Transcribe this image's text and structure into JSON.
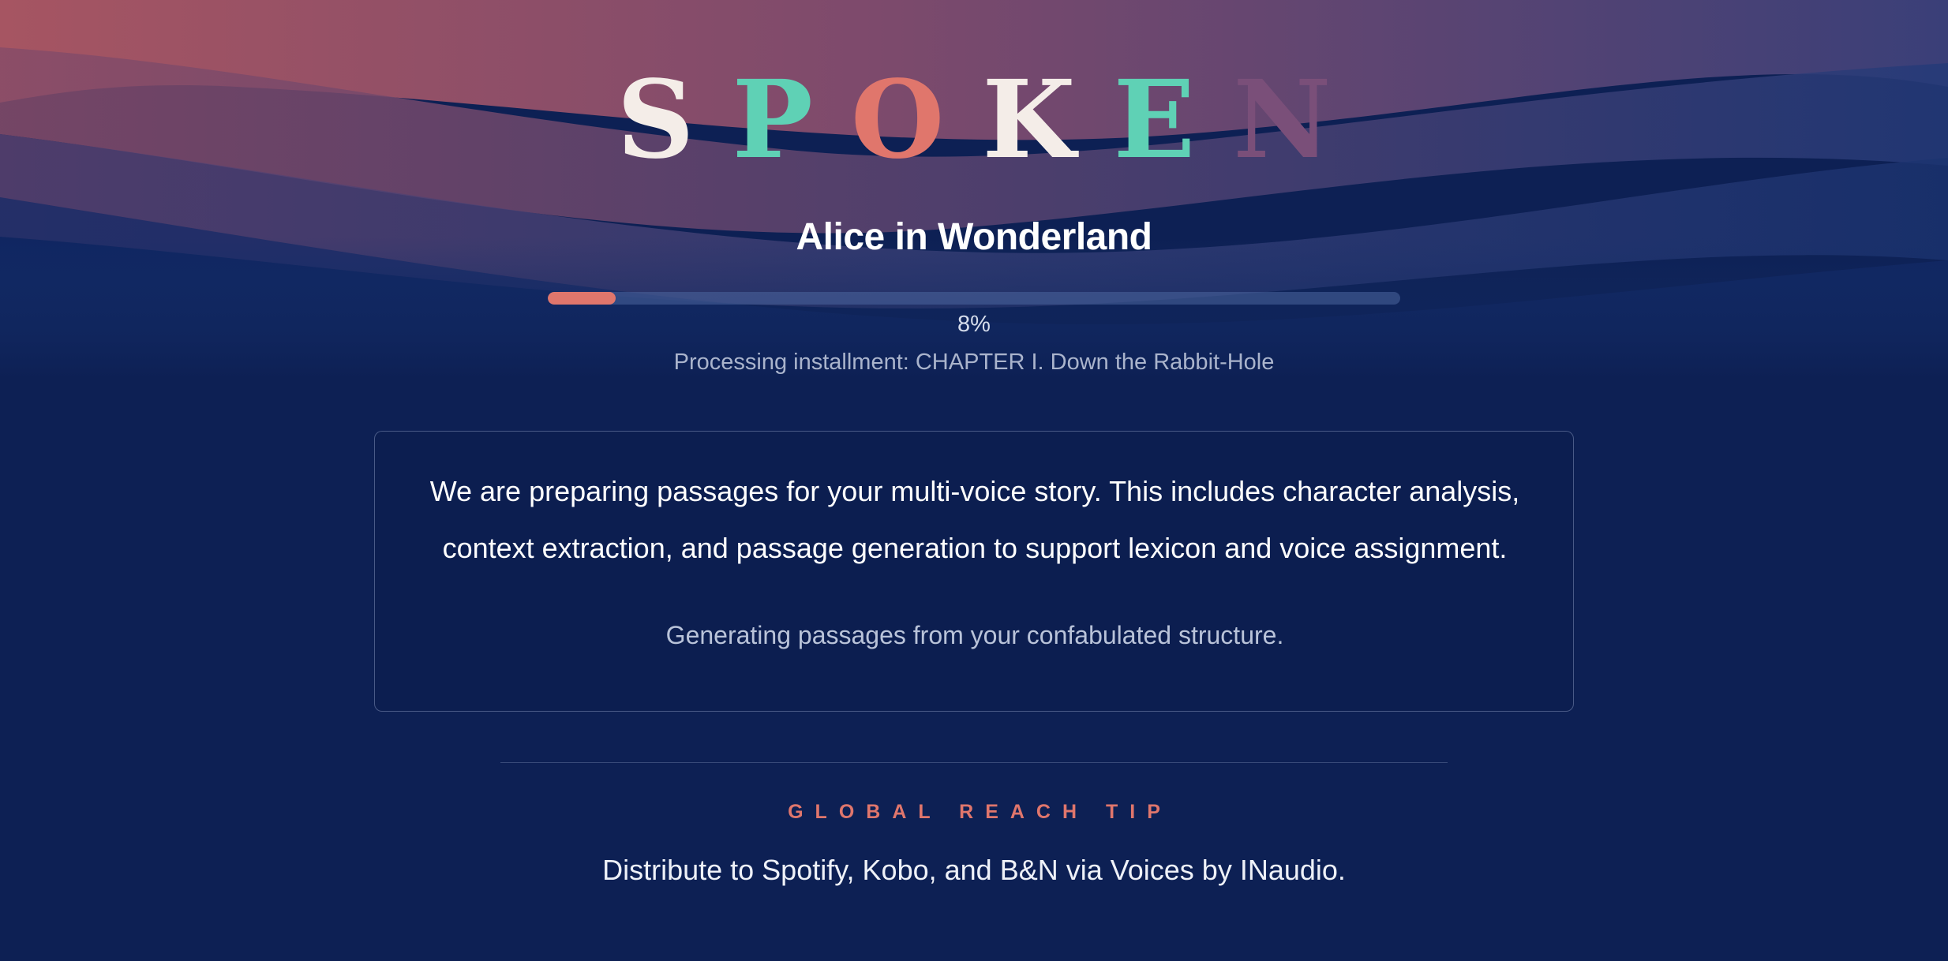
{
  "app": {
    "logo_letters": [
      "S",
      "P",
      "O",
      "K",
      "E",
      "N"
    ],
    "logo_colors": [
      "#f4ede8",
      "#5fd1b5",
      "#e0766c",
      "#f4ede8",
      "#5fd1b5",
      "#7a4f79"
    ]
  },
  "book": {
    "title": "Alice in Wonderland"
  },
  "progress": {
    "value": 0.08,
    "percent_label": "8%",
    "status": "Processing installment: CHAPTER I. Down the Rabbit-Hole"
  },
  "info_card": {
    "main_text": "We are preparing passages for your multi-voice story. This includes character analysis, context extraction, and passage generation to support lexicon and voice assignment.",
    "sub_text": "Generating passages from your confabulated structure."
  },
  "tip": {
    "label": "GLOBAL REACH TIP",
    "text": "Distribute to Spotify, Kobo, and B&N via Voices by INaudio."
  },
  "colors": {
    "background": "#0d2054",
    "accent": "#e0766c",
    "teal": "#5fd1b5",
    "plum": "#7a4f79"
  }
}
